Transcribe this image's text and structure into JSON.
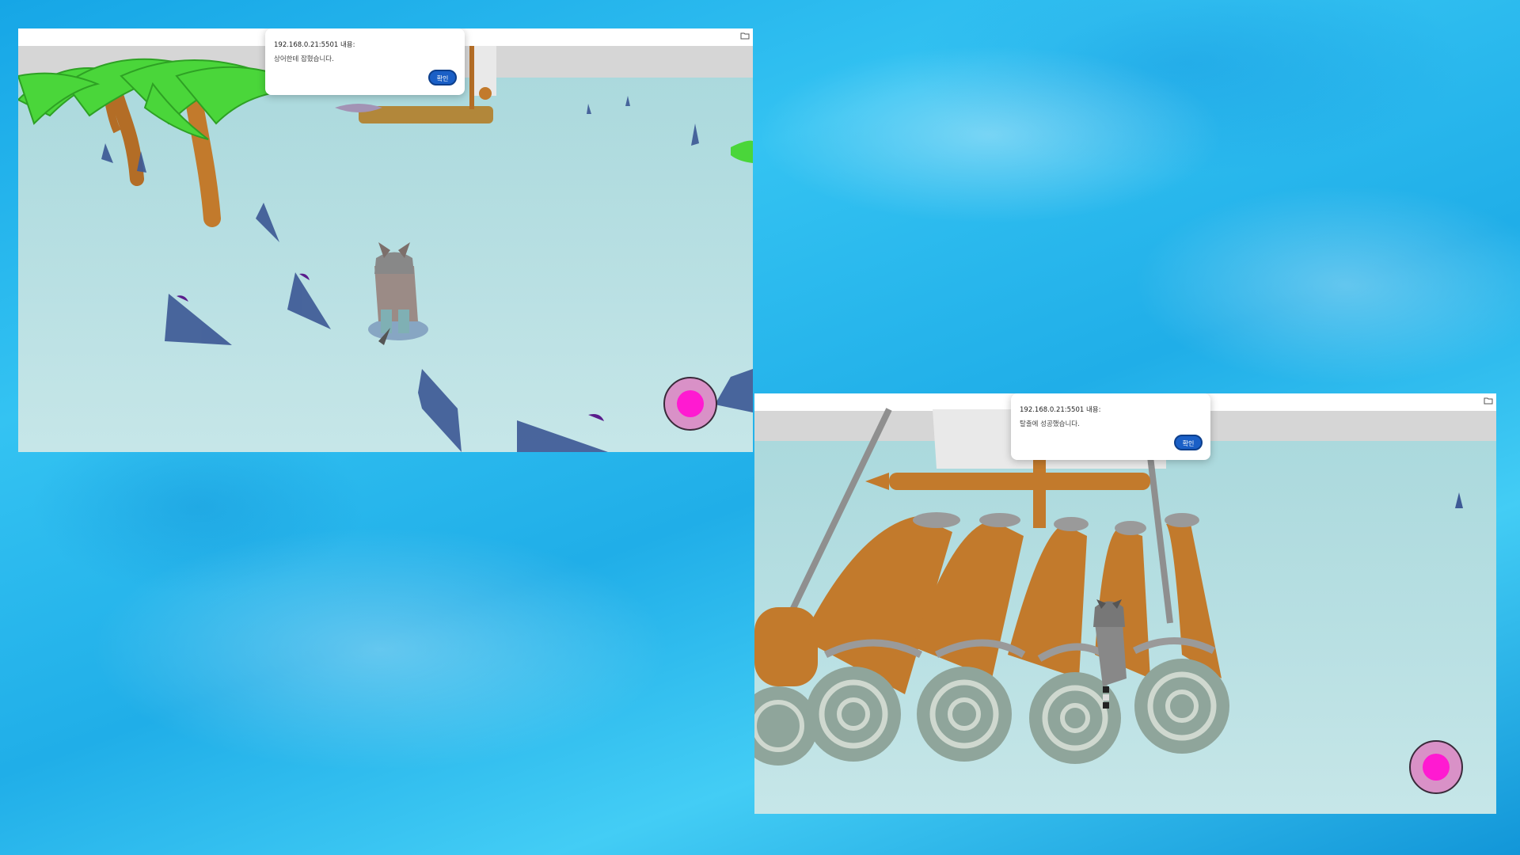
{
  "screenshots": [
    {
      "dialog": {
        "title": "192.168.0.21:5501 내용:",
        "message": "상어한테 잡혔습니다.",
        "ok_label": "확인"
      },
      "joystick_icon": "joystick-icon"
    },
    {
      "dialog": {
        "title": "192.168.0.21:5501 내용:",
        "message": "탈출에 성공했습니다.",
        "ok_label": "확인"
      },
      "joystick_icon": "joystick-icon"
    }
  ],
  "colors": {
    "ocean_background": "#20aee8",
    "water": "#a9d8dc",
    "dialog_button": "#1a5fc6",
    "joystick_outer": "#d991c7",
    "joystick_knob": "#ff1ad1",
    "log_wood": "#c27a2c",
    "shark_fin": "#3e5a96"
  }
}
